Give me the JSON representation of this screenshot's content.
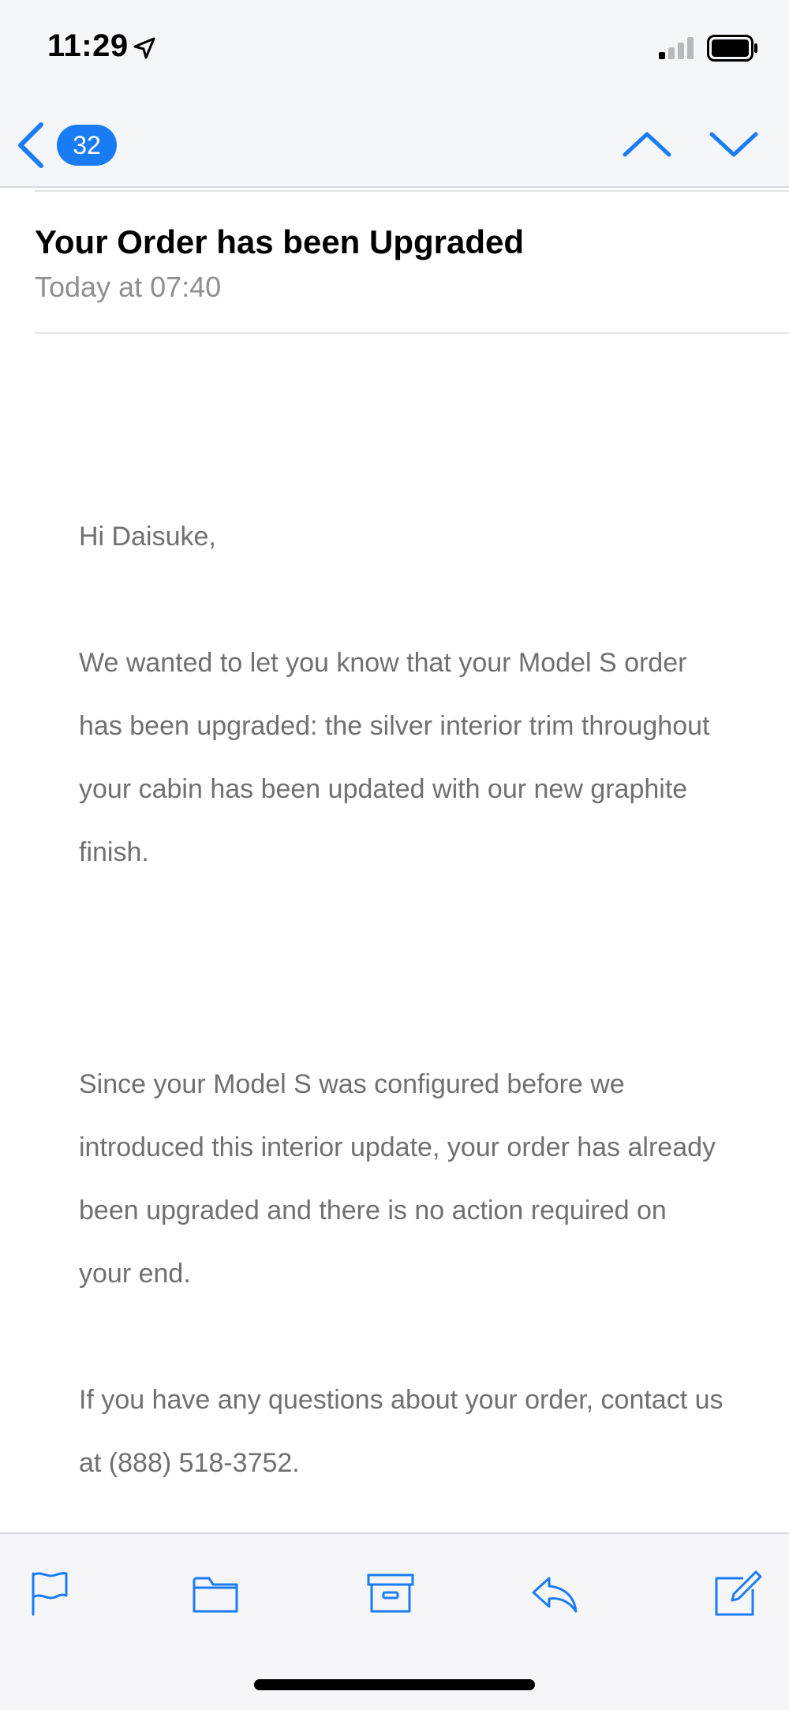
{
  "status_bar": {
    "time": "11:29",
    "icons": [
      "location-arrow-icon",
      "signal-icon",
      "battery-icon"
    ]
  },
  "nav": {
    "unread_count": "32",
    "icons": [
      "back-chevron-icon",
      "previous-message-icon",
      "next-message-icon"
    ]
  },
  "message": {
    "subject": "Your Order has been Upgraded",
    "date": "Today at 07:40",
    "greeting": "Hi Daisuke,",
    "paragraphs": [
      "We wanted to let you know that your Model S order has been upgraded: the silver interior trim throughout your cabin has been updated with our new graphite finish.",
      "Since your Model S was configured before we introduced this interior update, your order has already been upgraded and there is no action required on your end.",
      "If you have any questions about your order, contact us at (888) 518-3752."
    ]
  },
  "toolbar": {
    "icons": [
      "flag-icon",
      "folder-icon",
      "archive-icon",
      "reply-icon",
      "compose-icon"
    ]
  },
  "colors": {
    "accent": "#1a7cf5",
    "body_text": "#707070",
    "secondary_text": "#8e8e93",
    "bar_background": "#f4f6f9"
  }
}
